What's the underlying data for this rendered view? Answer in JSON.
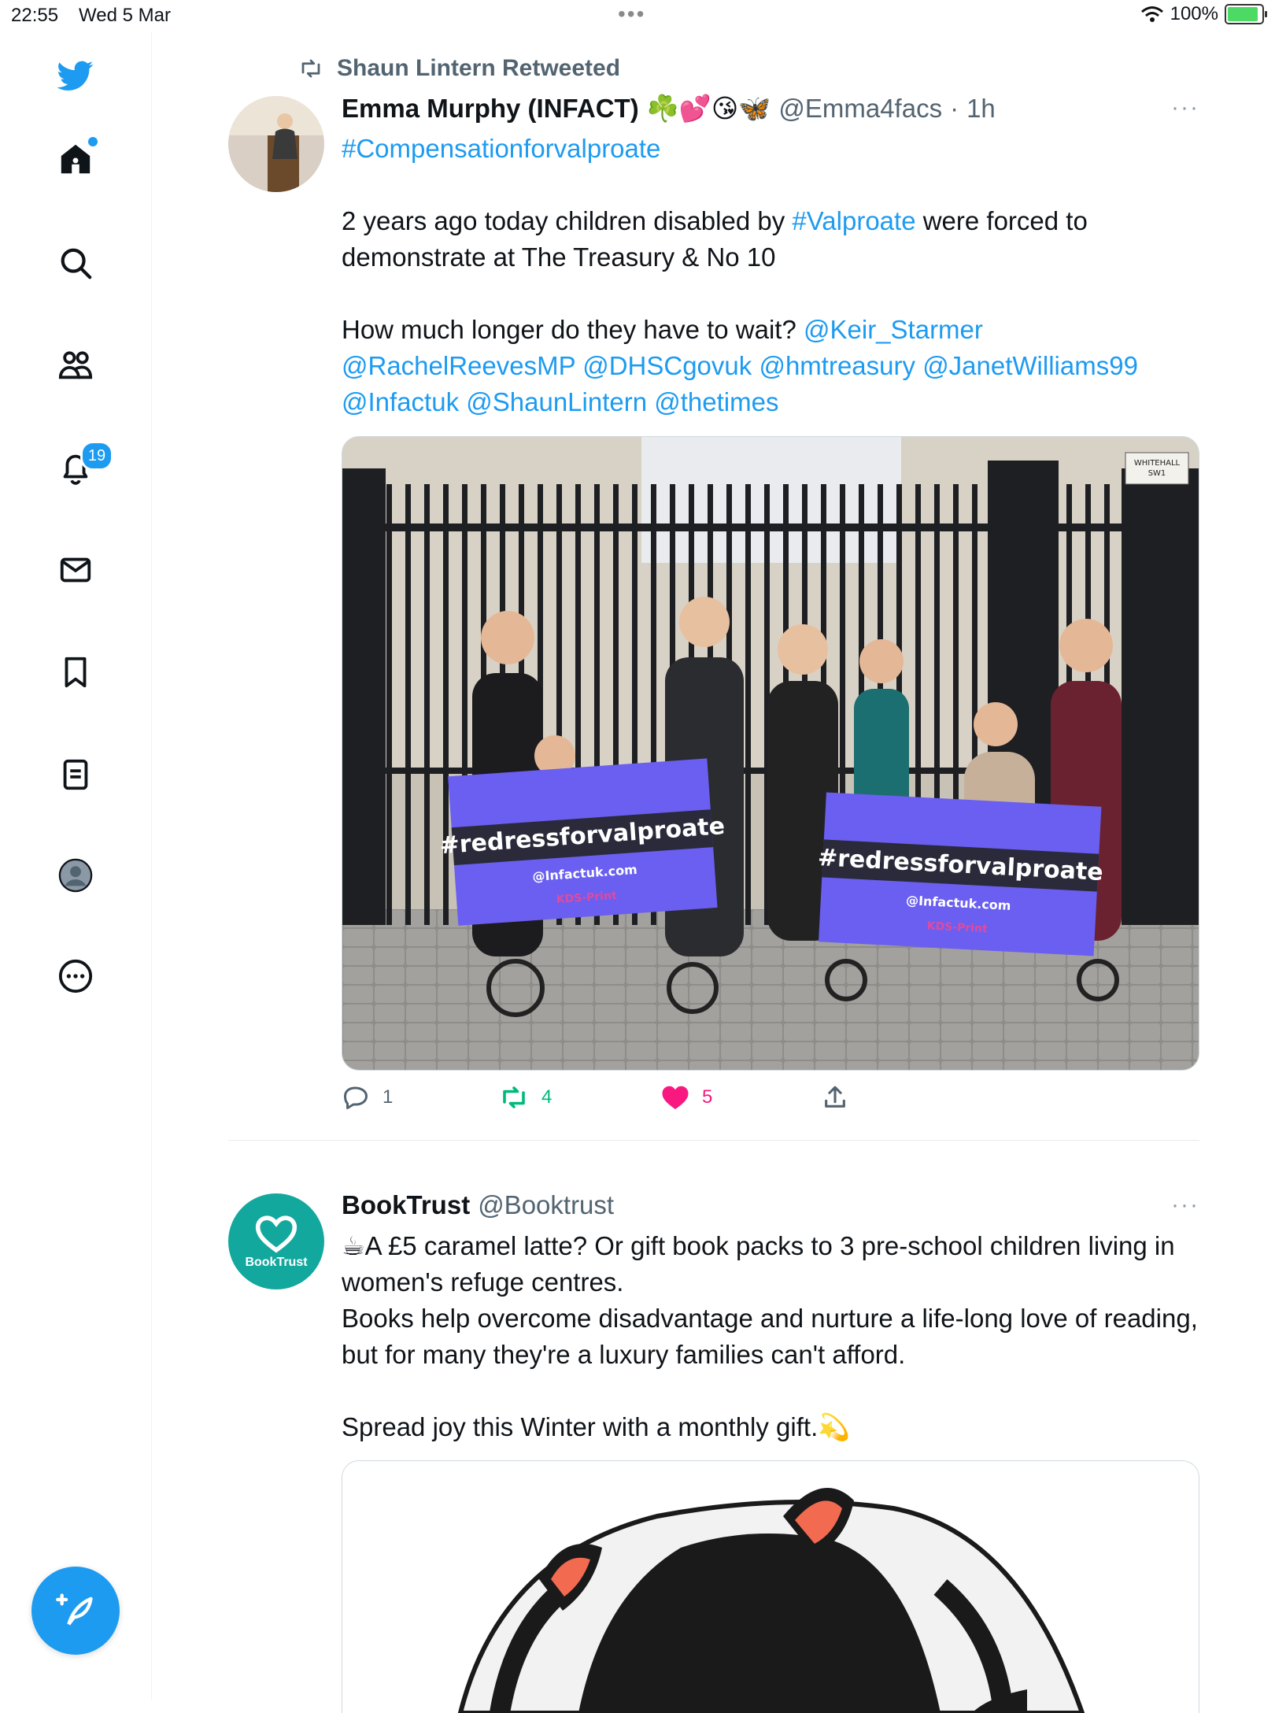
{
  "status_bar": {
    "time": "22:55",
    "date": "Wed 5 Mar",
    "battery": "100%"
  },
  "sidebar": {
    "items": [
      {
        "name": "twitter-logo",
        "icon": "bird-icon"
      },
      {
        "name": "home",
        "icon": "home-icon"
      },
      {
        "name": "explore",
        "icon": "search-icon"
      },
      {
        "name": "communities",
        "icon": "people-icon"
      },
      {
        "name": "notifications",
        "icon": "bell-icon",
        "badge": "19"
      },
      {
        "name": "messages",
        "icon": "mail-icon"
      },
      {
        "name": "bookmarks",
        "icon": "bookmark-icon"
      },
      {
        "name": "lists",
        "icon": "list-icon"
      },
      {
        "name": "profile",
        "icon": "profile-icon"
      },
      {
        "name": "more",
        "icon": "more-circle-icon"
      }
    ],
    "compose_icon": "compose-icon"
  },
  "tweets": [
    {
      "retweeted_by": "Shaun Lintern Retweeted",
      "name": "Emma Murphy (INFACT)",
      "emojis": "☘️💕😘🦋",
      "handle": "@Emma4facs",
      "sep": "·",
      "time": "1h",
      "more": "···",
      "line1": "#Compensationforvalproate",
      "p1_a": "2 years ago today children disabled by ",
      "p1_link": "#Valproate",
      "p1_b": " were forced to demonstrate at The Treasury & No 10",
      "p2_a": "How much longer do they have to wait? ",
      "mentions": [
        "@Keir_Starmer",
        "@RachelReevesMP",
        "@DHSCgovuk",
        "@hmtreasury",
        "@JanetWilliams99",
        "@Infactuk",
        "@ShaunLintern",
        "@thetimes"
      ],
      "photo": {
        "banner_text": "#redressforvalproate",
        "banner_url": "@Infactuk.com",
        "banner_printer": "KDS-Print",
        "sign_line1": "WHITEHALL",
        "sign_line2": "SW1"
      },
      "stats": {
        "replies": "1",
        "retweets": "4",
        "likes": "5"
      }
    },
    {
      "name": "BookTrust",
      "handle": "@Booktrust",
      "more": "···",
      "avatar_label": "BookTrust",
      "l1_emoji": "☕",
      "l1": "A £5 caramel latte? Or gift book packs to 3 pre-school children living in women's refuge centres.",
      "l2": "Books help overcome disadvantage and nurture a life-long love of reading, but for many they're a luxury families can't afford.",
      "l3": "Spread joy this Winter with a monthly gift.",
      "l3_emoji": "💫"
    }
  ],
  "colors": {
    "accent": "#1d9bf0",
    "retweet": "#00ba7c",
    "like": "#f91880",
    "banner": "#6a5ff0"
  }
}
